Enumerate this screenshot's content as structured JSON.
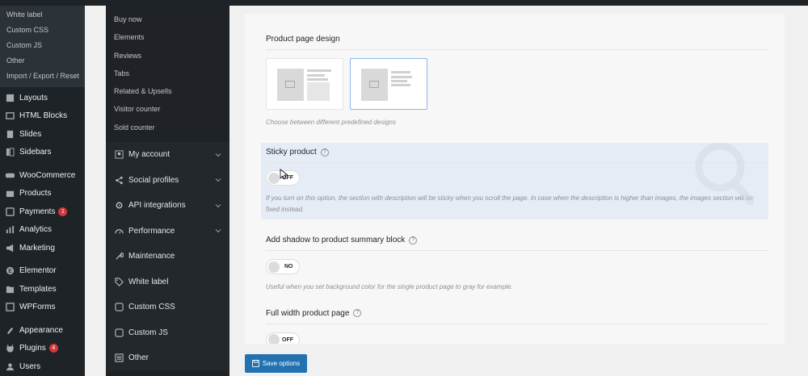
{
  "wp_sidebar": {
    "sub_items": [
      "White label",
      "Custom CSS",
      "Custom JS",
      "Other",
      "Import / Export / Reset"
    ],
    "items": [
      {
        "label": "Layouts",
        "icon": "layouts-icon"
      },
      {
        "label": "HTML Blocks",
        "icon": "html-blocks-icon"
      },
      {
        "label": "Slides",
        "icon": "slides-icon"
      },
      {
        "label": "Sidebars",
        "icon": "sidebars-icon"
      },
      {
        "label": "WooCommerce",
        "icon": "woocommerce-icon"
      },
      {
        "label": "Products",
        "icon": "products-icon"
      },
      {
        "label": "Payments",
        "icon": "payments-icon",
        "badge": "1"
      },
      {
        "label": "Analytics",
        "icon": "analytics-icon"
      },
      {
        "label": "Marketing",
        "icon": "marketing-icon"
      },
      {
        "label": "Elementor",
        "icon": "elementor-icon"
      },
      {
        "label": "Templates",
        "icon": "templates-icon"
      },
      {
        "label": "WPForms",
        "icon": "wpforms-icon"
      },
      {
        "label": "Appearance",
        "icon": "appearance-icon"
      },
      {
        "label": "Plugins",
        "icon": "plugins-icon",
        "badge": "4"
      },
      {
        "label": "Users",
        "icon": "users-icon"
      }
    ]
  },
  "theme_nav": {
    "sub_items": [
      "Buy now",
      "Elements",
      "Reviews",
      "Tabs",
      "Related & Upsells",
      "Visitor counter",
      "Sold counter"
    ],
    "main_items": [
      {
        "label": "My account",
        "icon": "account-icon",
        "chevron": true
      },
      {
        "label": "Social profiles",
        "icon": "share-icon",
        "chevron": true
      },
      {
        "label": "API integrations",
        "icon": "gear-icon",
        "chevron": true
      },
      {
        "label": "Performance",
        "icon": "speed-icon",
        "chevron": true
      },
      {
        "label": "Maintenance",
        "icon": "wrench-icon",
        "chevron": false
      },
      {
        "label": "White label",
        "icon": "tag-icon",
        "chevron": false
      },
      {
        "label": "Custom CSS",
        "icon": "code-icon",
        "chevron": false
      },
      {
        "label": "Custom JS",
        "icon": "code-icon",
        "chevron": false
      },
      {
        "label": "Other",
        "icon": "list-icon",
        "chevron": false
      }
    ]
  },
  "main": {
    "design": {
      "title": "Product page design",
      "description": "Choose between different predefined designs",
      "selected_index": 1
    },
    "sticky": {
      "title": "Sticky product",
      "toggle_label": "OFF",
      "description": "If you turn on this option, the section with description will be sticky when you scroll the page. In case when the description is higher than images, the images section will be fixed instead."
    },
    "shadow": {
      "title": "Add shadow to product summary block",
      "toggle_label": "NO",
      "description": "Useful when you set background color for the single product page to gray for example."
    },
    "fullwidth": {
      "title": "Full width product page",
      "toggle_label": "OFF"
    }
  },
  "save_button": "Save options",
  "colors": {
    "sidebar_bg": "#1d2327",
    "accent": "#2271b1",
    "highlight": "#e6ecf5",
    "badge": "#d63638"
  }
}
